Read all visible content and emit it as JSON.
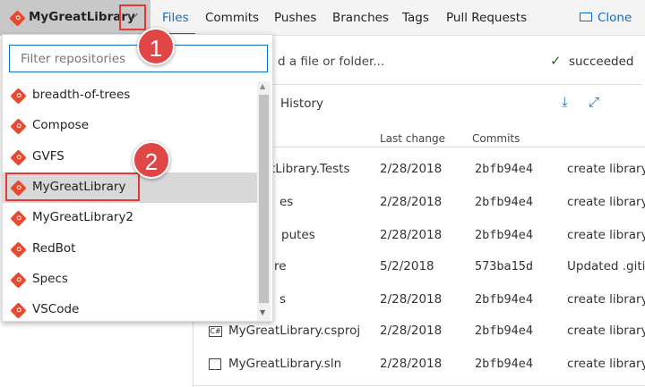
{
  "header": {
    "repo_name": "MyGreatLibrary",
    "tabs": [
      "Files",
      "Commits",
      "Pushes",
      "Branches",
      "Tags",
      "Pull Requests"
    ],
    "clone_label": "Clone"
  },
  "toolbar": {
    "path_placeholder_partial": "d a file or folder...",
    "build_status": "succeeded"
  },
  "history_label": "History",
  "table": {
    "headers": {
      "last_change": "Last change",
      "commits": "Commits"
    },
    "rows": [
      {
        "name": "tLibrary.Tests",
        "date": "2/28/2018",
        "commit": "2bfb94e4",
        "message": "create library"
      },
      {
        "name": "es",
        "date": "2/28/2018",
        "commit": "2bfb94e4",
        "message": "create library"
      },
      {
        "name": "putes",
        "date": "2/28/2018",
        "commit": "2bfb94e4",
        "message": "create library"
      },
      {
        "name": "re",
        "date": "5/2/2018",
        "commit": "573ba15d",
        "message": "Updated .gitig"
      },
      {
        "name": "s",
        "date": "2/28/2018",
        "commit": "2bfb94e4",
        "message": "create library"
      },
      {
        "name": "MyGreatLibrary.csproj",
        "date": "2/28/2018",
        "commit": "2bfb94e4",
        "message": "create library"
      },
      {
        "name": "MyGreatLibrary.sln",
        "date": "2/28/2018",
        "commit": "2bfb94e4",
        "message": "create library"
      }
    ]
  },
  "dropdown": {
    "filter_placeholder": "Filter repositories",
    "repos": [
      "breadth-of-trees",
      "Compose",
      "GVFS",
      "MyGreatLibrary",
      "MyGreatLibrary2",
      "RedBot",
      "Specs",
      "VSCode"
    ],
    "selected": "MyGreatLibrary"
  },
  "callouts": [
    "1",
    "2"
  ]
}
